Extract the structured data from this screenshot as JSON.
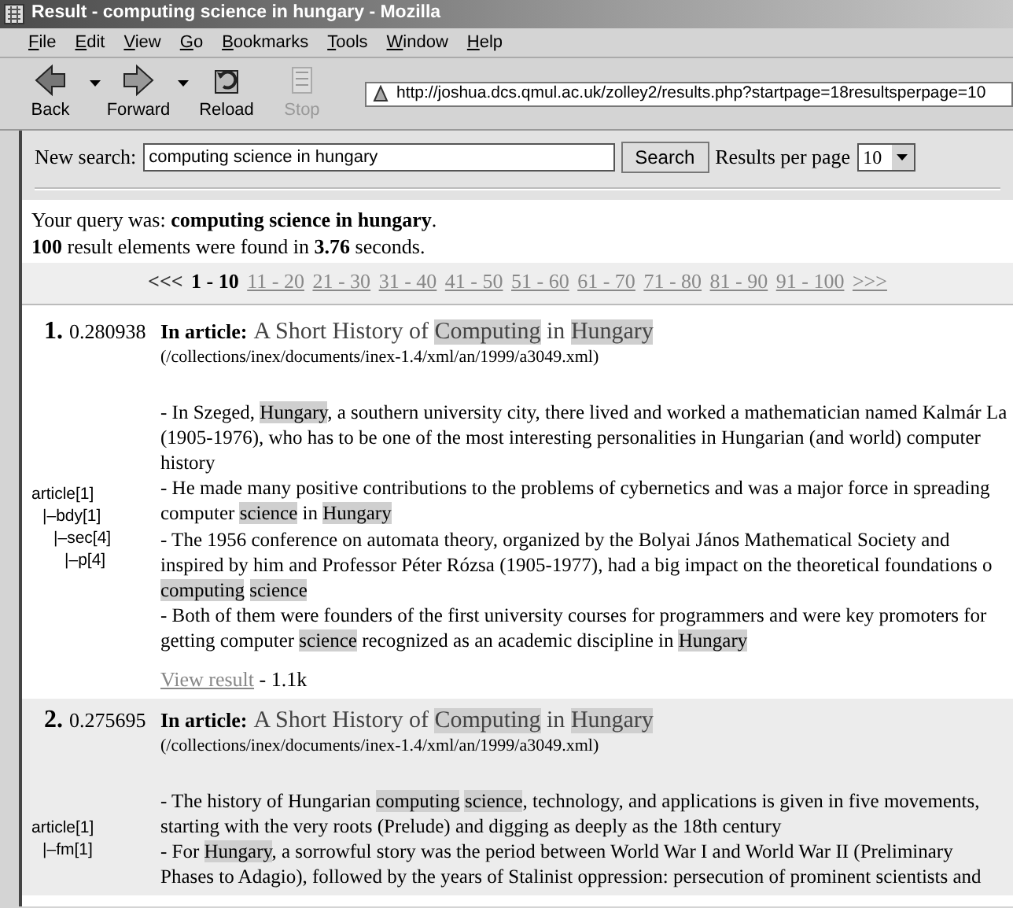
{
  "window": {
    "title": "Result - computing science in hungary - Mozilla"
  },
  "menu": [
    "File",
    "Edit",
    "View",
    "Go",
    "Bookmarks",
    "Tools",
    "Window",
    "Help"
  ],
  "toolbar": [
    {
      "label": "Back",
      "kind": "back",
      "disabled": false,
      "dropdown": true
    },
    {
      "label": "Forward",
      "kind": "forward",
      "disabled": false,
      "dropdown": true
    },
    {
      "label": "Reload",
      "kind": "reload",
      "disabled": false,
      "dropdown": false
    },
    {
      "label": "Stop",
      "kind": "stop",
      "disabled": true,
      "dropdown": false
    }
  ],
  "address": {
    "url": "http://joshua.dcs.qmul.ac.uk/zolley2/results.php?startpage=18resultsperpage=10"
  },
  "search": {
    "label": "New search:",
    "value": "computing science in hungary",
    "button": "Search",
    "per_page_label": "Results per page",
    "per_page": "10"
  },
  "summary": [
    "Your query was: **computing science in hungary**.",
    "**100** result elements were found in **3.76** seconds."
  ],
  "pagination": [
    {
      "label": "<<<",
      "selected": false,
      "disabled": true
    },
    {
      "label": "1 - 10",
      "selected": true,
      "disabled": false
    },
    {
      "label": "11 - 20",
      "selected": false,
      "disabled": false
    },
    {
      "label": "21 - 30",
      "selected": false,
      "disabled": false
    },
    {
      "label": "31 - 40",
      "selected": false,
      "disabled": false
    },
    {
      "label": "41 - 50",
      "selected": false,
      "disabled": false
    },
    {
      "label": "51 - 60",
      "selected": false,
      "disabled": false
    },
    {
      "label": "61 - 70",
      "selected": false,
      "disabled": false
    },
    {
      "label": "71 - 80",
      "selected": false,
      "disabled": false
    },
    {
      "label": "81 - 90",
      "selected": false,
      "disabled": false
    },
    {
      "label": "91 - 100",
      "selected": false,
      "disabled": false
    },
    {
      "label": ">>>",
      "selected": false,
      "disabled": false
    }
  ],
  "results": [
    {
      "rank": "1.",
      "score": "0.280938",
      "shaded": false,
      "type_label": "In article:",
      "title": [
        {
          "text": "A Short History of ",
          "highlight": false
        },
        {
          "text": "Computing",
          "highlight": true
        },
        {
          "text": " in ",
          "highlight": false
        },
        {
          "text": "Hungary",
          "highlight": true
        }
      ],
      "path": "(/collections/inex/documents/inex-1.4/xml/an/1999/a3049.xml)",
      "tree": [
        {
          "label": "article[1]",
          "children": [
            {
              "label": "|–bdy[1]",
              "children": [
                {
                  "label": "|–sec[4]",
                  "children": [
                    {
                      "label": "|–p[4]"
                    }
                  ]
                }
              ]
            }
          ]
        }
      ],
      "snippets": [
        [
          [
            {
              "text": "- In Szeged, ",
              "highlight": false
            },
            {
              "text": "Hungary",
              "highlight": true
            },
            {
              "text": ", a southern university city, there lived and worked a mathematician named Kalmár La",
              "highlight": false
            }
          ],
          [
            {
              "text": "(1905-1976), who has to be one of the most interesting personalities in Hungarian (and world) computer",
              "highlight": false
            }
          ],
          [
            {
              "text": "history",
              "highlight": false
            }
          ]
        ],
        [
          [
            {
              "text": "- He made many positive contributions to the problems of cybernetics and was a major force in spreading",
              "highlight": false
            }
          ],
          [
            {
              "text": "computer ",
              "highlight": false
            },
            {
              "text": "science",
              "highlight": true
            },
            {
              "text": " in ",
              "highlight": false
            },
            {
              "text": "Hungary",
              "highlight": true
            }
          ]
        ],
        [
          [
            {
              "text": "- The 1956 conference on automata theory, organized by the Bolyai János Mathematical Society and",
              "highlight": false
            }
          ],
          [
            {
              "text": "inspired by him and Professor Péter Rózsa (1905-1977), had a big impact on the theoretical foundations o",
              "highlight": false
            }
          ],
          [
            {
              "text": "computing",
              "highlight": true
            },
            {
              "text": "science",
              "highlight": true
            }
          ]
        ],
        [
          [
            {
              "text": "- Both of them were founders of the first university courses for programmers and were key promoters for",
              "highlight": false
            }
          ],
          [
            {
              "text": "getting computer ",
              "highlight": false
            },
            {
              "text": "science",
              "highlight": true
            },
            {
              "text": " recognized as an academic discipline in ",
              "highlight": false
            },
            {
              "text": "Hungary",
              "highlight": true
            }
          ]
        ]
      ],
      "view_link": "View result",
      "size": "- 1.1k"
    },
    {
      "rank": "2.",
      "score": "0.275695",
      "shaded": true,
      "type_label": "In article:",
      "title": [
        {
          "text": "A Short History of ",
          "highlight": false
        },
        {
          "text": "Computing",
          "highlight": true
        },
        {
          "text": " in ",
          "highlight": false
        },
        {
          "text": "Hungary",
          "highlight": true
        }
      ],
      "path": "(/collections/inex/documents/inex-1.4/xml/an/1999/a3049.xml)",
      "tree": [
        {
          "label": "article[1]",
          "children": [
            {
              "label": "|–fm[1]"
            }
          ]
        }
      ],
      "snippets": [
        [
          [
            {
              "text": "- The history of Hungarian ",
              "highlight": false
            },
            {
              "text": "computing",
              "highlight": true
            },
            {
              "text": "science",
              "highlight": true
            },
            {
              "text": ", technology, and applications is given in five movements,",
              "highlight": false
            }
          ],
          [
            {
              "text": "starting with the very roots (Prelude) and digging as deeply as the 18th century",
              "highlight": false
            }
          ]
        ],
        [
          [
            {
              "text": "- For ",
              "highlight": false
            },
            {
              "text": "Hungary",
              "highlight": true
            },
            {
              "text": ", a sorrowful story was the period between World War I and World War II (Preliminary",
              "highlight": false
            }
          ],
          [
            {
              "text": "Phases to Adagio), followed by the years of Stalinist oppression: persecution of prominent scientists and",
              "highlight": false
            }
          ]
        ]
      ]
    }
  ]
}
